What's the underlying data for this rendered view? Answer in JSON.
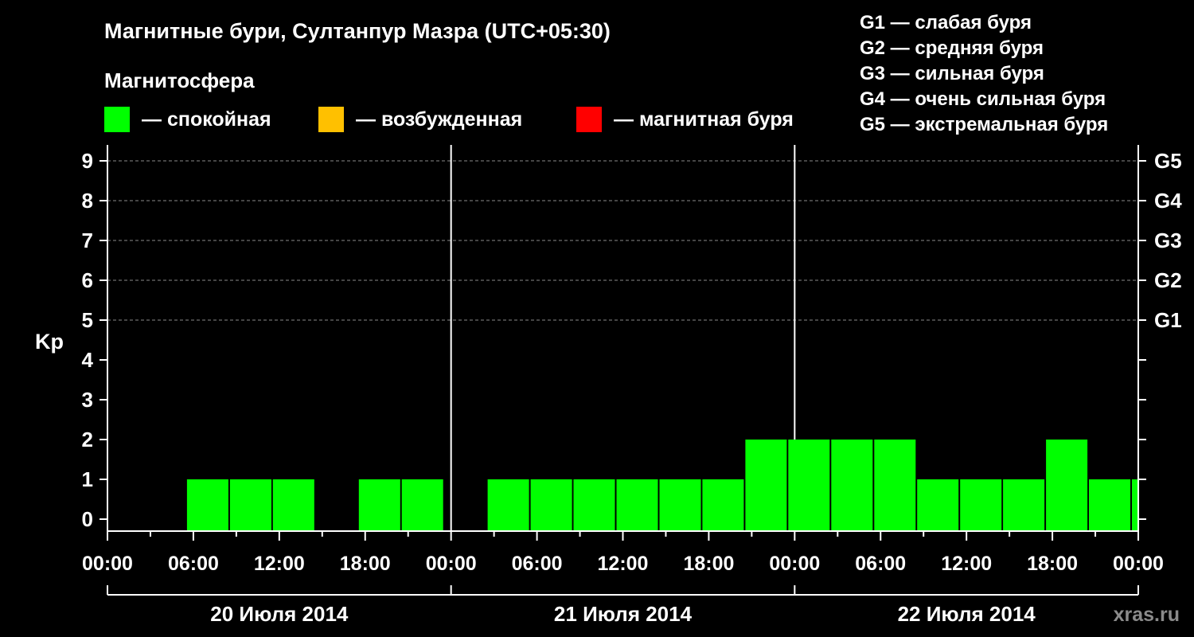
{
  "chart_data": {
    "type": "bar",
    "title": "Магнитные бури, Султанпур Мазра (UTC+05:30)",
    "legend_title": "Магнитосфера",
    "legend": [
      {
        "label": "— спокойная",
        "color": "#00ff00"
      },
      {
        "label": "— возбужденная",
        "color": "#ffc000"
      },
      {
        "label": "— магнитная буря",
        "color": "#ff0000"
      }
    ],
    "storm_scale": [
      "G1 — слабая буря",
      "G2 — средняя буря",
      "G3 — сильная буря",
      "G4 — очень сильная буря",
      "G5 — экстремальная буря"
    ],
    "ylabel": "Kp",
    "ylim": [
      0,
      9
    ],
    "yticks": [
      0,
      1,
      2,
      3,
      4,
      5,
      6,
      7,
      8,
      9
    ],
    "right_ticks": [
      {
        "kp": 5,
        "label": "G1"
      },
      {
        "kp": 6,
        "label": "G2"
      },
      {
        "kp": 7,
        "label": "G3"
      },
      {
        "kp": 8,
        "label": "G4"
      },
      {
        "kp": 9,
        "label": "G5"
      }
    ],
    "grid": "dashed lines at Kp 5–9",
    "xticks": [
      "00:00",
      "06:00",
      "12:00",
      "18:00",
      "00:00",
      "06:00",
      "12:00",
      "18:00",
      "00:00",
      "06:00",
      "12:00",
      "18:00",
      "00:00"
    ],
    "days": [
      "20 Июля 2014",
      "21 Июля 2014",
      "22 Июля 2014"
    ],
    "bar_duration_hours": 3,
    "series": [
      {
        "bars": [
          {
            "start": "2014-07-20 05:30",
            "kp": 1
          },
          {
            "start": "2014-07-20 08:30",
            "kp": 1
          },
          {
            "start": "2014-07-20 11:30",
            "kp": 1
          },
          {
            "start": "2014-07-20 17:30",
            "kp": 1
          },
          {
            "start": "2014-07-20 20:30",
            "kp": 1
          },
          {
            "start": "2014-07-21 02:30",
            "kp": 1
          },
          {
            "start": "2014-07-21 05:30",
            "kp": 1
          },
          {
            "start": "2014-07-21 08:30",
            "kp": 1
          },
          {
            "start": "2014-07-21 11:30",
            "kp": 1
          },
          {
            "start": "2014-07-21 14:30",
            "kp": 1
          },
          {
            "start": "2014-07-21 17:30",
            "kp": 1
          },
          {
            "start": "2014-07-21 20:30",
            "kp": 2
          },
          {
            "start": "2014-07-21 23:30",
            "kp": 2
          },
          {
            "start": "2014-07-22 02:30",
            "kp": 2
          },
          {
            "start": "2014-07-22 05:30",
            "kp": 2
          },
          {
            "start": "2014-07-22 08:30",
            "kp": 1
          },
          {
            "start": "2014-07-22 11:30",
            "kp": 1
          },
          {
            "start": "2014-07-22 14:30",
            "kp": 1
          },
          {
            "start": "2014-07-22 17:30",
            "kp": 2
          },
          {
            "start": "2014-07-22 20:30",
            "kp": 1
          },
          {
            "start": "2014-07-22 23:30",
            "kp": 1
          }
        ]
      }
    ]
  },
  "watermark": "xras.ru"
}
